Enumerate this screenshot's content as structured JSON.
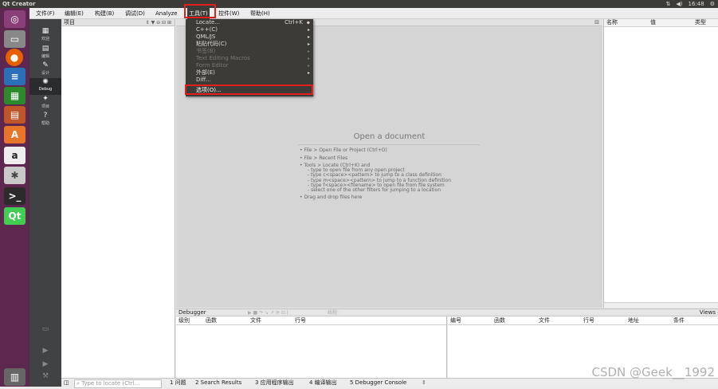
{
  "topbar": {
    "title": "Qt Creator",
    "time": "16:48"
  },
  "menubar": {
    "items": [
      "文件(F)",
      "编辑(E)",
      "构建(B)",
      "调试(D)",
      "Analyze",
      "工具(T)",
      "控件(W)",
      "帮助(H)"
    ]
  },
  "modes": [
    {
      "label": "欢迎",
      "icon": "grid"
    },
    {
      "label": "编辑",
      "icon": "doc"
    },
    {
      "label": "设计",
      "icon": "pen"
    },
    {
      "label": "Debug",
      "icon": "bug"
    },
    {
      "label": "项目",
      "icon": "wrench"
    },
    {
      "label": "帮助",
      "icon": "help"
    }
  ],
  "project_panel": {
    "title": "项目"
  },
  "tools_menu": {
    "items": [
      {
        "label": "Locate...",
        "shortcut": "Ctrl+K",
        "disabled": false,
        "submenu": false
      },
      {
        "label": "C++(C)",
        "shortcut": "",
        "disabled": false,
        "submenu": true
      },
      {
        "label": "QML/JS",
        "shortcut": "",
        "disabled": false,
        "submenu": true
      },
      {
        "label": "粘贴代码(C)",
        "shortcut": "",
        "disabled": false,
        "submenu": true
      },
      {
        "label": "书签(B)",
        "shortcut": "",
        "disabled": true,
        "submenu": true
      },
      {
        "label": "Text Editing Macros",
        "shortcut": "",
        "disabled": true,
        "submenu": true
      },
      {
        "label": "Form Editor",
        "shortcut": "",
        "disabled": true,
        "submenu": true
      },
      {
        "label": "外部(E)",
        "shortcut": "",
        "disabled": false,
        "submenu": true
      },
      {
        "label": "Diff...",
        "shortcut": "",
        "disabled": false,
        "submenu": false
      },
      {
        "label": "选项(O)...",
        "shortcut": "",
        "disabled": false,
        "submenu": false
      }
    ]
  },
  "editor": {
    "open_title": "Open a document",
    "hints": [
      "• File > Open File or Project (Ctrl+O)",
      "• File > Recent Files",
      "• Tools > Locate (Ctrl+K) and",
      "- type to open file from any open project",
      "- type c<space><pattern> to jump to a class definition",
      "- type m<space><pattern> to jump to a function definition",
      "- type f<space><filename> to open file from file system",
      "- select one of the other filters for jumping to a location",
      "• Drag and drop files here"
    ]
  },
  "variables": {
    "columns": [
      "名称",
      "值",
      "类型"
    ]
  },
  "debugger": {
    "title": "Debugger",
    "threads_label": "线程:",
    "views_label": "Views",
    "stack_columns": [
      "级别",
      "函数",
      "文件",
      "行号"
    ],
    "bp_columns": [
      "编号",
      "函数",
      "文件",
      "行号",
      "地址",
      "条件"
    ]
  },
  "statusbar": {
    "locate_placeholder": "Type to locate (Ctrl...",
    "tabs": [
      "1 问题",
      "2 Search Results",
      "3 应用程序输出",
      "4 编译输出",
      "5 Debugger Console"
    ]
  },
  "watermark": "CSDN @Geek__1992",
  "colors": {
    "highlight_box": "#e0201c",
    "launcher": "#5e2750",
    "menu_bg": "#3c3b37"
  }
}
